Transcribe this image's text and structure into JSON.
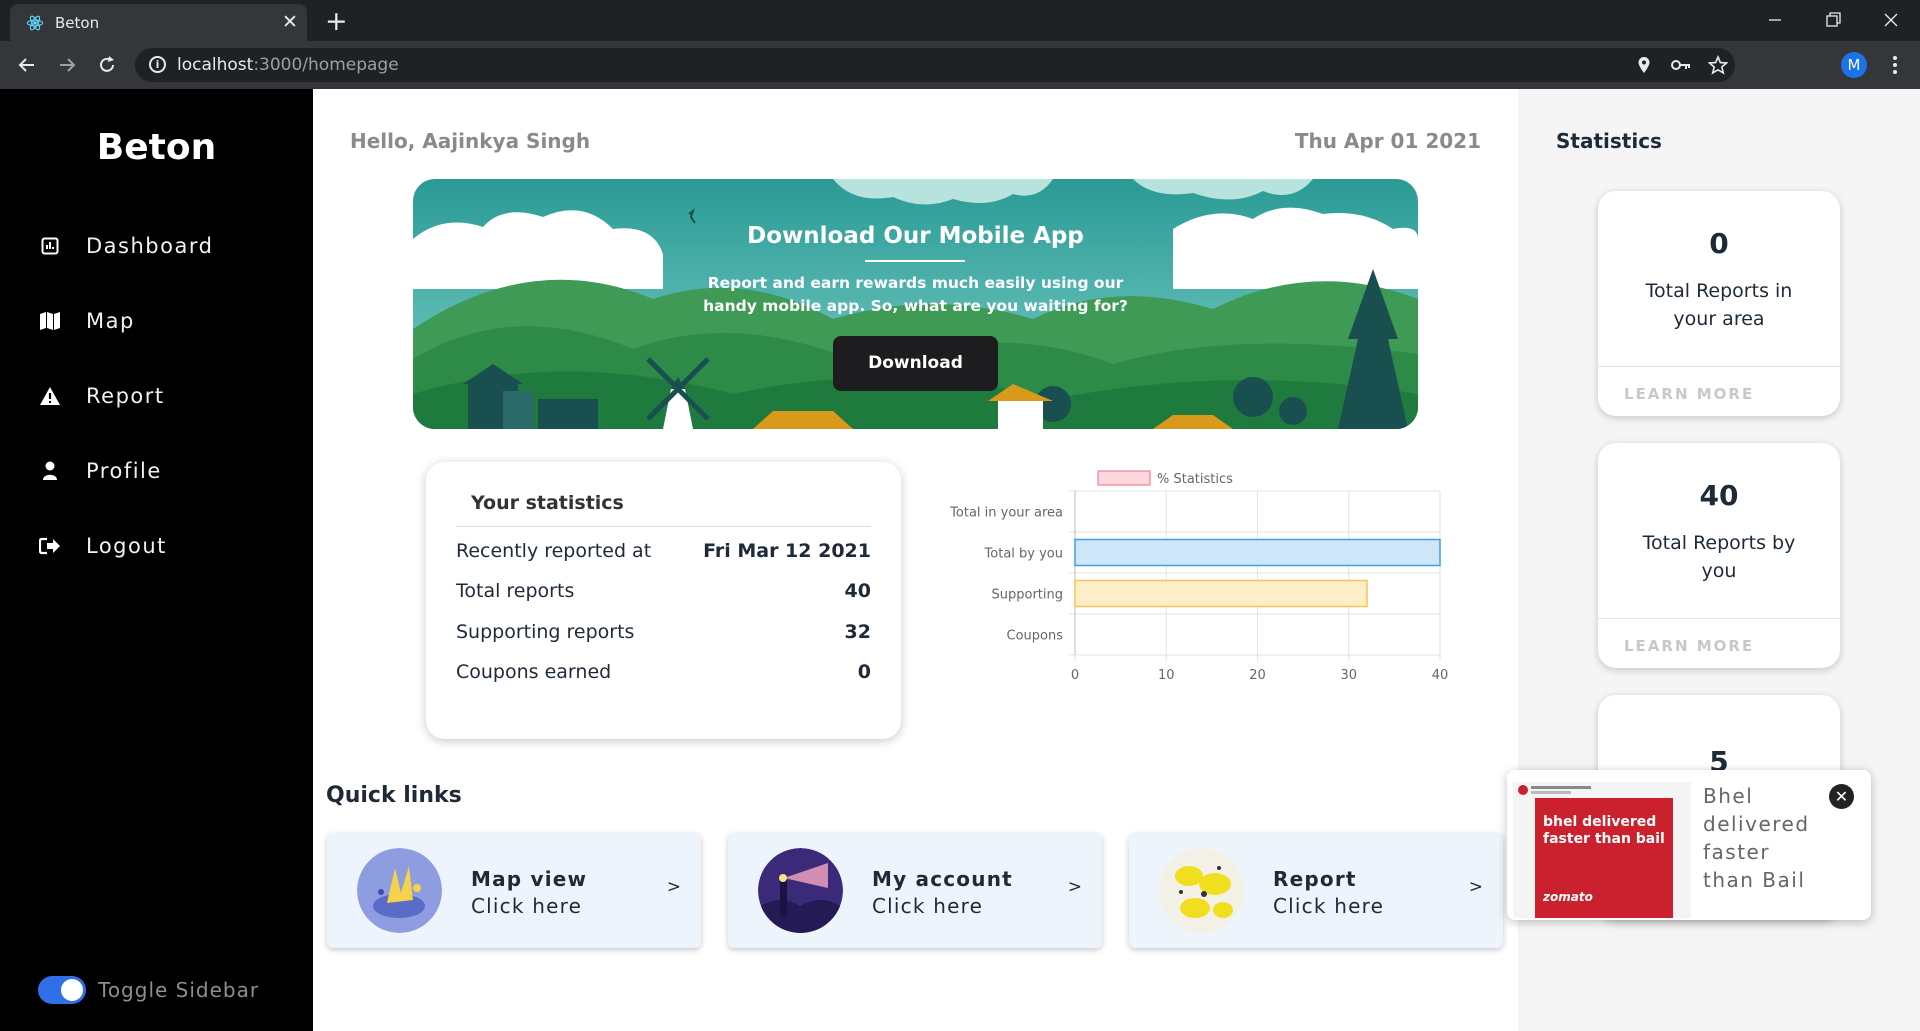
{
  "browser": {
    "tab_title": "Beton",
    "tab_close": "✕",
    "new_tab": "+",
    "url_host": "localhost",
    "url_path": ":3000/homepage",
    "profile_initial": "M",
    "icons": [
      "react-favicon-icon",
      "back-icon",
      "forward-icon",
      "reload-icon",
      "info-icon",
      "location-icon",
      "key-icon",
      "star-icon",
      "menu-icon"
    ]
  },
  "sidebar": {
    "brand": "Beton",
    "items": [
      {
        "label": "Dashboard",
        "icon": "chart-box-icon"
      },
      {
        "label": "Map",
        "icon": "map-icon"
      },
      {
        "label": "Report",
        "icon": "warning-icon"
      },
      {
        "label": "Profile",
        "icon": "user-icon"
      },
      {
        "label": "Logout",
        "icon": "logout-icon"
      }
    ],
    "toggle_label": "Toggle Sidebar"
  },
  "header": {
    "greeting": "Hello, Aajinkya Singh",
    "date": "Thu Apr 01 2021"
  },
  "banner": {
    "title": "Download Our Mobile App",
    "text_line1": "Report and earn rewards much easily using our",
    "text_line2": "handy mobile app. So, what are you waiting for?",
    "button": "Download"
  },
  "your_statistics": {
    "title": "Your statistics",
    "rows": [
      {
        "label": "Recently reported at",
        "value": "Fri Mar 12 2021"
      },
      {
        "label": "Total reports",
        "value": "40"
      },
      {
        "label": "Supporting reports",
        "value": "32"
      },
      {
        "label": "Coupons earned",
        "value": "0"
      }
    ]
  },
  "chart_data": {
    "type": "bar",
    "orientation": "horizontal",
    "categories": [
      "Total in your area",
      "Total by you",
      "Supporting",
      "Coupons"
    ],
    "series": [
      {
        "name": "% Statistics",
        "values": [
          0,
          40,
          32,
          0
        ]
      }
    ],
    "xlim": [
      0,
      40
    ],
    "xticks": [
      "0",
      "10",
      "20",
      "30",
      "40"
    ],
    "bar_colors": [
      "#f8c5cf",
      "#cfe6f8",
      "#fdeec7",
      "#e6e6fa"
    ],
    "bar_borders": [
      "#f06a88",
      "#3aa0e8",
      "#f5c453",
      "#9b9bd9"
    ],
    "legend_position": "top",
    "grid": true
  },
  "quick_links": {
    "title": "Quick links",
    "items": [
      {
        "title": "Map view",
        "subtitle": "Click here",
        "arrow": ">"
      },
      {
        "title": "My account",
        "subtitle": "Click here",
        "arrow": ">"
      },
      {
        "title": "Report",
        "subtitle": "Click here",
        "arrow": ">"
      }
    ]
  },
  "right_panel": {
    "title": "Statistics",
    "cards": [
      {
        "value": "0",
        "label": "Total Reports in your area",
        "link": "LEARN MORE"
      },
      {
        "value": "40",
        "label": "Total Reports by you",
        "link": "LEARN MORE"
      },
      {
        "value": "5"
      }
    ]
  },
  "ad_toast": {
    "text": "Bhel delivered faster than Bail",
    "ad_headline": "bhel delivered faster than bail",
    "ad_brand": "zomato",
    "close": "✕"
  }
}
